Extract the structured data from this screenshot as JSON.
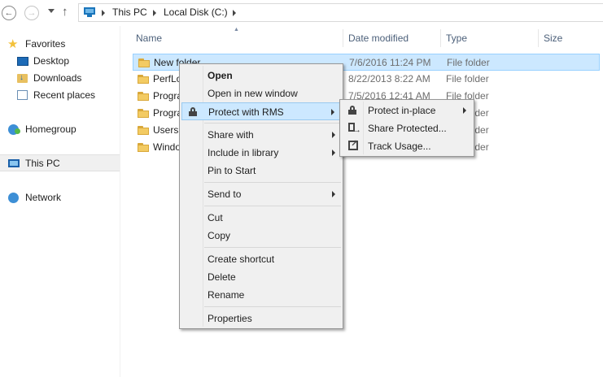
{
  "address_bar": {
    "path": [
      "This PC",
      "Local Disk (C:)"
    ]
  },
  "sidebar": {
    "items": [
      {
        "label": "Favorites",
        "icon": "star-icon"
      },
      {
        "label": "Desktop",
        "icon": "desktop-icon"
      },
      {
        "label": "Downloads",
        "icon": "downloads-icon"
      },
      {
        "label": "Recent places",
        "icon": "recent-places-icon"
      },
      {
        "label": "Homegroup",
        "icon": "homegroup-icon"
      },
      {
        "label": "This PC",
        "icon": "this-pc-icon",
        "selected": true
      },
      {
        "label": "Network",
        "icon": "network-icon"
      }
    ]
  },
  "columns": {
    "name": "Name",
    "date_modified": "Date modified",
    "type": "Type",
    "size": "Size"
  },
  "files": [
    {
      "name": "New folder",
      "date": "7/6/2016 11:24 PM",
      "type": "File folder",
      "selected": true
    },
    {
      "name": "PerfLogs",
      "date": "8/22/2013 8:22 AM",
      "type": "File folder"
    },
    {
      "name": "Program Files",
      "date": "7/5/2016 12:41 AM",
      "type": "File folder"
    },
    {
      "name": "Program Files (x86)",
      "date": "",
      "type": "File folder"
    },
    {
      "name": "Users",
      "date": "",
      "type": "File folder"
    },
    {
      "name": "Windows",
      "date": "",
      "type": "File folder"
    }
  ],
  "context_menu": {
    "open": "Open",
    "open_new_window": "Open in new window",
    "protect_rms": "Protect with RMS",
    "share_with": "Share with",
    "include_library": "Include in library",
    "pin_start": "Pin to Start",
    "send_to": "Send to",
    "cut": "Cut",
    "copy": "Copy",
    "create_shortcut": "Create shortcut",
    "delete": "Delete",
    "rename": "Rename",
    "properties": "Properties"
  },
  "rms_submenu": {
    "protect_in_place": "Protect in-place",
    "share_protected": "Share Protected...",
    "track_usage": "Track Usage..."
  }
}
